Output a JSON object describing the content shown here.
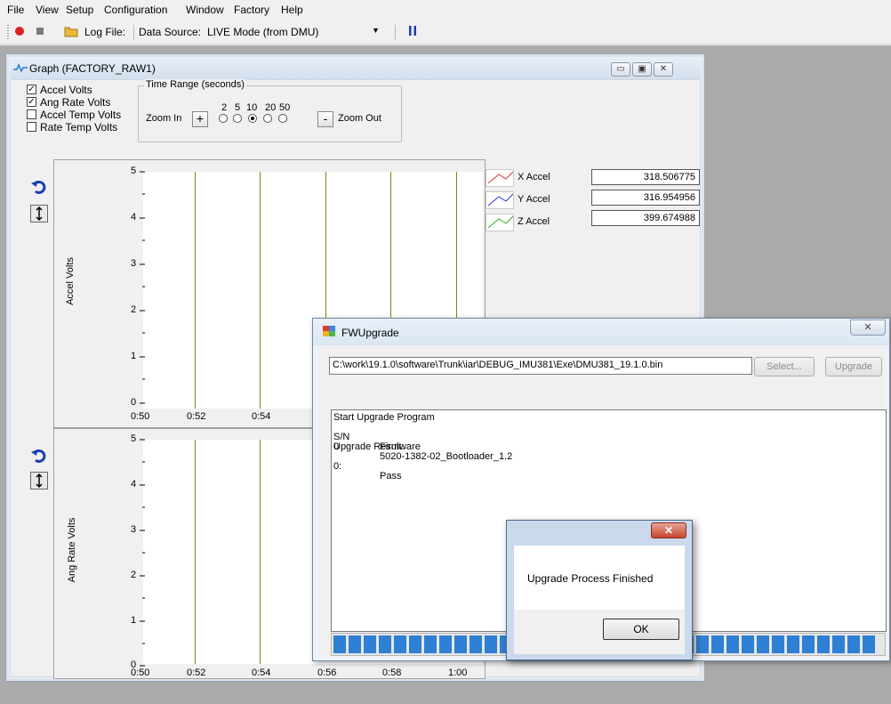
{
  "menu": [
    "File",
    "View",
    "Setup",
    "Configuration",
    "Window",
    "Factory",
    "Help"
  ],
  "toolbar": {
    "log_file_label": "Log File:",
    "data_source_label": "Data Source:",
    "data_source_value": "LIVE Mode (from DMU)",
    "pause_icon": "pause-icon"
  },
  "graph_window": {
    "title": "Graph (FACTORY_RAW1)",
    "checkboxes": [
      {
        "label": "Accel Volts",
        "checked": true
      },
      {
        "label": "Ang Rate Volts",
        "checked": true
      },
      {
        "label": "Accel Temp Volts",
        "checked": false
      },
      {
        "label": "Rate Temp Volts",
        "checked": false
      }
    ],
    "time_range": {
      "title": "Time Range (seconds)",
      "zoom_in": "Zoom In",
      "zoom_out": "Zoom Out",
      "plus": "+",
      "minus": "-",
      "options": [
        "2",
        "5",
        "10",
        "20",
        "50"
      ],
      "selected": "10"
    },
    "legend": [
      {
        "label": "X Accel",
        "value": "318.506775",
        "color": "#e03030"
      },
      {
        "label": "Y Accel",
        "value": "316.954956",
        "color": "#3030e0"
      },
      {
        "label": "Z Accel",
        "value": "399.674988",
        "color": "#30b030"
      }
    ],
    "plot1": {
      "ylabel": "Accel Volts",
      "yticks": [
        "5",
        "4",
        "3",
        "2",
        "1",
        "0"
      ],
      "xticks": [
        "0:50",
        "0:52",
        "0:54"
      ]
    },
    "plot2": {
      "ylabel": "Ang Rate Volts",
      "yticks": [
        "5",
        "4",
        "3",
        "2",
        "1",
        "0"
      ],
      "xticks": [
        "0:50",
        "0:52",
        "0:54",
        "0:56",
        "0:58",
        "1:00"
      ]
    }
  },
  "fw_dialog": {
    "title": "FWUpgrade",
    "path": "C:\\work\\19.1.0\\software\\Trunk\\iar\\DEBUG_IMU381\\Exe\\DMU381_19.1.0.bin",
    "select_button": "Select...",
    "upgrade_button": "Upgrade",
    "log": {
      "line1": "Start Upgrade Program",
      "col_sn": "S/N",
      "col_fw": "Firmware",
      "sn": "0",
      "fw": "5020-1382-02_Bootloader_1.2",
      "result_label": "Upgrade Result:",
      "result_idx": "0:",
      "result": "Pass"
    }
  },
  "message_box": {
    "text": "Upgrade Process Finished",
    "ok": "OK"
  }
}
